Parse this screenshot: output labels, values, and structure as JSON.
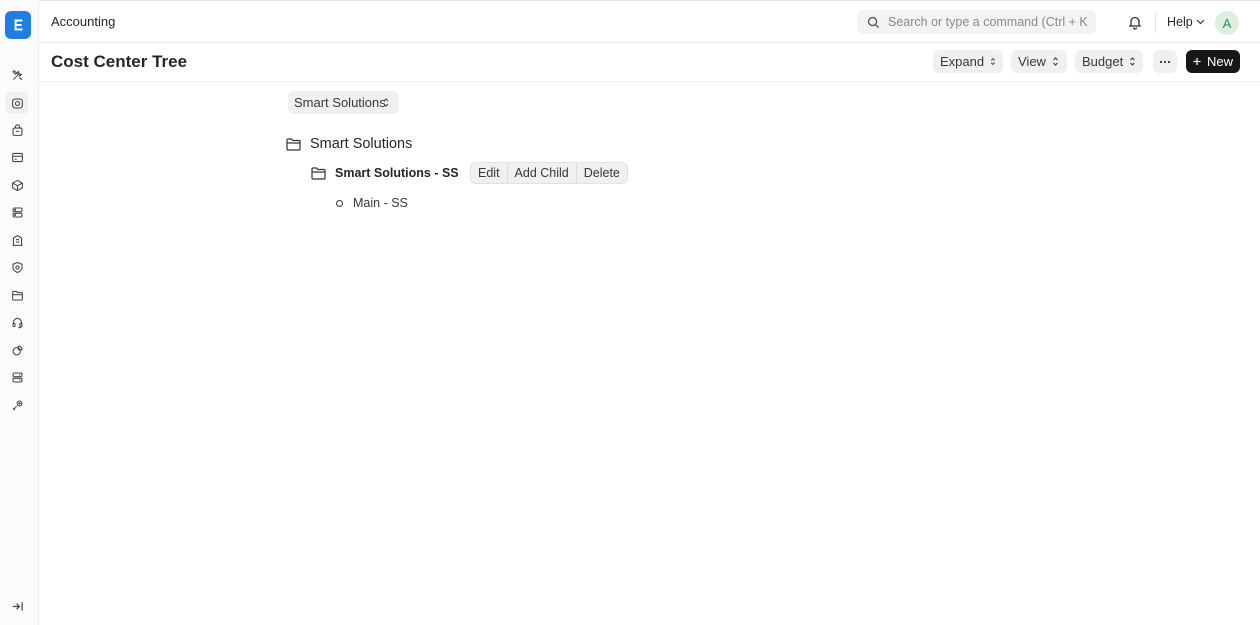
{
  "app": {
    "title": "Accounting"
  },
  "search": {
    "placeholder": "Search or type a command (Ctrl + K)"
  },
  "header": {
    "help_label": "Help",
    "avatar_initial": "A"
  },
  "page": {
    "title": "Cost Center Tree",
    "buttons": {
      "expand": "Expand",
      "view": "View",
      "budget": "Budget",
      "new": "New"
    }
  },
  "company_select": {
    "value": "Smart Solutions"
  },
  "tree": {
    "root": {
      "label": "Smart Solutions"
    },
    "child": {
      "label": "Smart Solutions - SS"
    },
    "leaf": {
      "label": "Main - SS"
    },
    "actions": {
      "edit": "Edit",
      "add_child": "Add Child",
      "delete": "Delete"
    }
  },
  "sidebar": {
    "icons": [
      "tools-icon",
      "accounting-icon",
      "buying-icon",
      "selling-icon",
      "stock-icon",
      "assets-icon",
      "hr-icon",
      "quality-icon",
      "projects-icon",
      "support-icon",
      "integrations-icon",
      "servers-icon",
      "settings-icon"
    ]
  },
  "colors": {
    "brand": "#1f7ee6",
    "primary_button": "#171717"
  }
}
